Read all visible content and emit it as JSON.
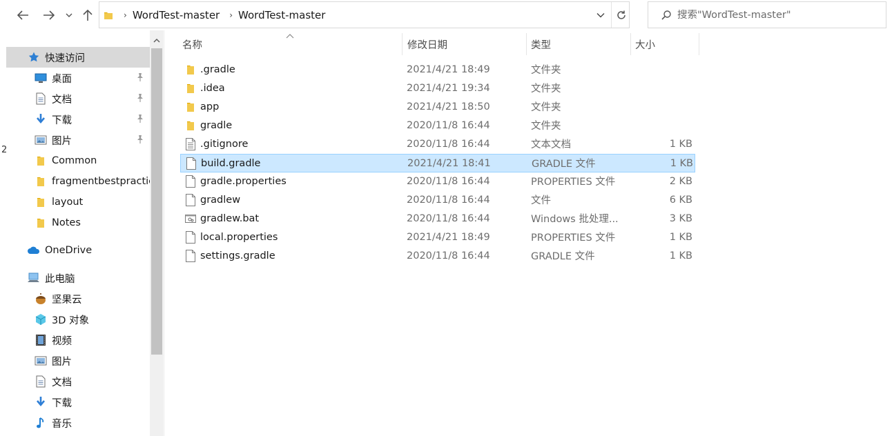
{
  "window": {
    "breadcrumbs": [
      "WordTest-master",
      "WordTest-master"
    ],
    "search_placeholder": "搜索\"WordTest-master\"",
    "edge_digit": "2"
  },
  "sidebar": {
    "items": [
      {
        "label": "快速访问",
        "icon": "star-icon",
        "selected": true
      },
      {
        "label": "桌面",
        "icon": "desktop-icon",
        "pinned": true
      },
      {
        "label": "文档",
        "icon": "document-icon",
        "pinned": true
      },
      {
        "label": "下载",
        "icon": "download-icon",
        "pinned": true
      },
      {
        "label": "图片",
        "icon": "picture-icon",
        "pinned": true
      },
      {
        "label": "Common",
        "icon": "folder-icon"
      },
      {
        "label": "fragmentbestpractice",
        "icon": "folder-icon"
      },
      {
        "label": "layout",
        "icon": "folder-icon"
      },
      {
        "label": "Notes",
        "icon": "folder-icon"
      },
      {
        "label": "OneDrive",
        "icon": "cloud-icon"
      },
      {
        "label": "此电脑",
        "icon": "computer-icon"
      },
      {
        "label": "坚果云",
        "icon": "nut-icon"
      },
      {
        "label": "3D 对象",
        "icon": "cube-icon"
      },
      {
        "label": "视频",
        "icon": "video-icon"
      },
      {
        "label": "图片",
        "icon": "picture-icon"
      },
      {
        "label": "文档",
        "icon": "document-icon"
      },
      {
        "label": "下载",
        "icon": "download-icon"
      },
      {
        "label": "音乐",
        "icon": "music-icon"
      }
    ]
  },
  "columns": {
    "name": "名称",
    "date": "修改日期",
    "type": "类型",
    "size": "大小"
  },
  "files": [
    {
      "name": ".gradle",
      "date": "2021/4/21 18:49",
      "type": "文件夹",
      "size": "",
      "icon": "folder-icon"
    },
    {
      "name": ".idea",
      "date": "2021/4/21 19:34",
      "type": "文件夹",
      "size": "",
      "icon": "folder-icon"
    },
    {
      "name": "app",
      "date": "2021/4/21 18:50",
      "type": "文件夹",
      "size": "",
      "icon": "folder-icon"
    },
    {
      "name": "gradle",
      "date": "2020/11/8 16:44",
      "type": "文件夹",
      "size": "",
      "icon": "folder-icon"
    },
    {
      "name": ".gitignore",
      "date": "2020/11/8 16:44",
      "type": "文本文档",
      "size": "1 KB",
      "icon": "text-file-icon"
    },
    {
      "name": "build.gradle",
      "date": "2021/4/21 18:41",
      "type": "GRADLE 文件",
      "size": "1 KB",
      "icon": "file-icon",
      "selected": true
    },
    {
      "name": "gradle.properties",
      "date": "2020/11/8 16:44",
      "type": "PROPERTIES 文件",
      "size": "2 KB",
      "icon": "file-icon"
    },
    {
      "name": "gradlew",
      "date": "2020/11/8 16:44",
      "type": "文件",
      "size": "6 KB",
      "icon": "file-icon"
    },
    {
      "name": "gradlew.bat",
      "date": "2020/11/8 16:44",
      "type": "Windows 批处理...",
      "size": "3 KB",
      "icon": "batch-file-icon"
    },
    {
      "name": "local.properties",
      "date": "2021/4/21 18:49",
      "type": "PROPERTIES 文件",
      "size": "1 KB",
      "icon": "file-icon"
    },
    {
      "name": "settings.gradle",
      "date": "2020/11/8 16:44",
      "type": "GRADLE 文件",
      "size": "1 KB",
      "icon": "file-icon"
    }
  ]
}
